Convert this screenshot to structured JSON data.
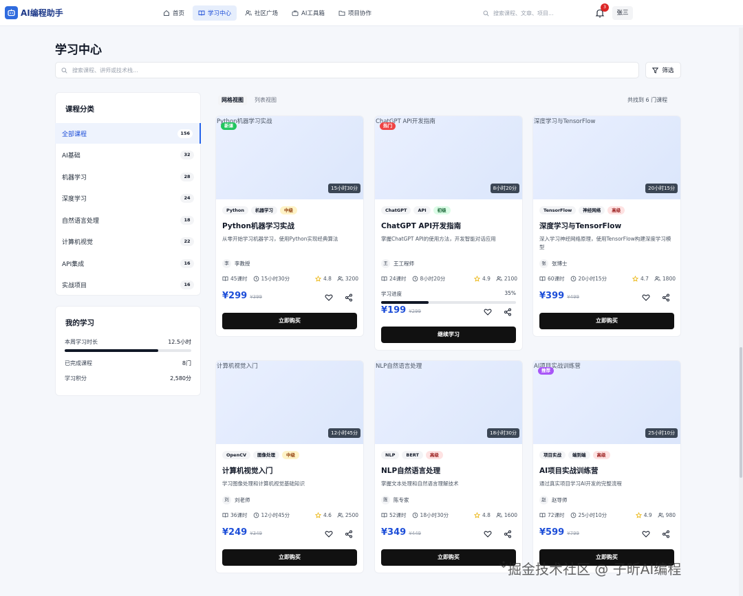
{
  "app": {
    "name": "AI编程助手"
  },
  "nav": [
    {
      "label": "首页",
      "icon": "home-icon"
    },
    {
      "label": "学习中心",
      "icon": "book-icon"
    },
    {
      "label": "社区广场",
      "icon": "users-icon"
    },
    {
      "label": "AI工具箱",
      "icon": "toolbox-icon"
    },
    {
      "label": "项目协作",
      "icon": "folder-icon"
    }
  ],
  "header": {
    "search_placeholder": "搜索课程、文章、项目...",
    "notification_count": "3",
    "user_name": "张三"
  },
  "page": {
    "title": "学习中心",
    "search_placeholder": "搜索课程、讲师或技术栈...",
    "filter_label": "筛选"
  },
  "categories": {
    "title": "课程分类",
    "items": [
      {
        "label": "全部课程",
        "count": "156"
      },
      {
        "label": "AI基础",
        "count": "32"
      },
      {
        "label": "机器学习",
        "count": "28"
      },
      {
        "label": "深度学习",
        "count": "24"
      },
      {
        "label": "自然语言处理",
        "count": "18"
      },
      {
        "label": "计算机视觉",
        "count": "22"
      },
      {
        "label": "API集成",
        "count": "16"
      },
      {
        "label": "实战项目",
        "count": "16"
      }
    ]
  },
  "my_learning": {
    "title": "我的学习",
    "weekly_label": "本周学习时长",
    "weekly_value": "12.5小时",
    "weekly_progress": 0.74,
    "completed_label": "已完成课程",
    "completed_value": "8门",
    "points_label": "学习积分",
    "points_value": "2,580分"
  },
  "toolbar": {
    "grid_view": "网格视图",
    "list_view": "列表视图",
    "result_text": "共找到 6 门课程"
  },
  "courses": [
    {
      "alt": "Python机器学习实战",
      "badge": "新课",
      "badge_color": "#22c55e",
      "duration": "15小时30分",
      "tags": [
        "Python",
        "机器学习"
      ],
      "level": "中级",
      "level_color": "#fef3c7",
      "level_text_color": "#92400e",
      "title": "Python机器学习实战",
      "desc": "从零开始学习机器学习，使用Python实现经典算法",
      "avatar": "李",
      "author": "李教授",
      "lessons": "45课时",
      "time": "15小时30分",
      "rating": "4.8",
      "students": "3200",
      "price": "¥299",
      "old_price": "¥399",
      "cta": "立即购买"
    },
    {
      "alt": "ChatGPT API开发指南",
      "badge": "热门",
      "badge_color": "#ef4444",
      "duration": "8小时20分",
      "tags": [
        "ChatGPT",
        "API"
      ],
      "level": "初级",
      "level_color": "#dcfce7",
      "level_text_color": "#166534",
      "title": "ChatGPT API开发指南",
      "desc": "掌握ChatGPT API的使用方法，开发智能对话应用",
      "avatar": "王",
      "author": "王工程师",
      "lessons": "24课时",
      "time": "8小时20分",
      "rating": "4.9",
      "students": "2100",
      "progress_label": "学习进度",
      "progress_text": "35%",
      "progress": 0.35,
      "price": "¥199",
      "old_price": "¥299",
      "cta": "继续学习"
    },
    {
      "alt": "深度学习与TensorFlow",
      "badge": "",
      "badge_color": "",
      "duration": "20小时15分",
      "tags": [
        "TensorFlow",
        "神经网络"
      ],
      "level": "高级",
      "level_color": "#fee2e2",
      "level_text_color": "#991b1b",
      "title": "深度学习与TensorFlow",
      "desc": "深入学习神经网络原理，使用TensorFlow构建深度学习模型",
      "avatar": "张",
      "author": "张博士",
      "lessons": "60课时",
      "time": "20小时15分",
      "rating": "4.7",
      "students": "1800",
      "price": "¥399",
      "old_price": "¥499",
      "cta": "立即购买"
    },
    {
      "alt": "计算机视觉入门",
      "badge": "",
      "badge_color": "",
      "duration": "12小时45分",
      "tags": [
        "OpenCV",
        "图像处理"
      ],
      "level": "中级",
      "level_color": "#fef3c7",
      "level_text_color": "#92400e",
      "title": "计算机视觉入门",
      "desc": "学习图像处理和计算机视觉基础知识",
      "avatar": "刘",
      "author": "刘老师",
      "lessons": "36课时",
      "time": "12小时45分",
      "rating": "4.6",
      "students": "2500",
      "price": "¥249",
      "old_price": "¥349",
      "cta": "立即购买"
    },
    {
      "alt": "NLP自然语言处理",
      "badge": "",
      "badge_color": "",
      "duration": "18小时30分",
      "tags": [
        "NLP",
        "BERT"
      ],
      "level": "高级",
      "level_color": "#fee2e2",
      "level_text_color": "#991b1b",
      "title": "NLP自然语言处理",
      "desc": "掌握文本处理和自然语言理解技术",
      "avatar": "陈",
      "author": "陈专家",
      "lessons": "52课时",
      "time": "18小时30分",
      "rating": "4.8",
      "students": "1600",
      "price": "¥349",
      "old_price": "¥449",
      "cta": "立即购买"
    },
    {
      "alt": "AI项目实战训练营",
      "badge": "推荐",
      "badge_color": "#a855f7",
      "duration": "25小时10分",
      "tags": [
        "项目实战",
        "端到端"
      ],
      "level": "高级",
      "level_color": "#fee2e2",
      "level_text_color": "#991b1b",
      "title": "AI项目实战训练营",
      "desc": "通过真实项目学习AI开发的完整流程",
      "avatar": "赵",
      "author": "赵导师",
      "lessons": "72课时",
      "time": "25小时10分",
      "rating": "4.9",
      "students": "980",
      "price": "¥599",
      "old_price": "¥799",
      "cta": "立即购买"
    }
  ],
  "watermark": "掘金技术社区 @ 子昕AI编程"
}
